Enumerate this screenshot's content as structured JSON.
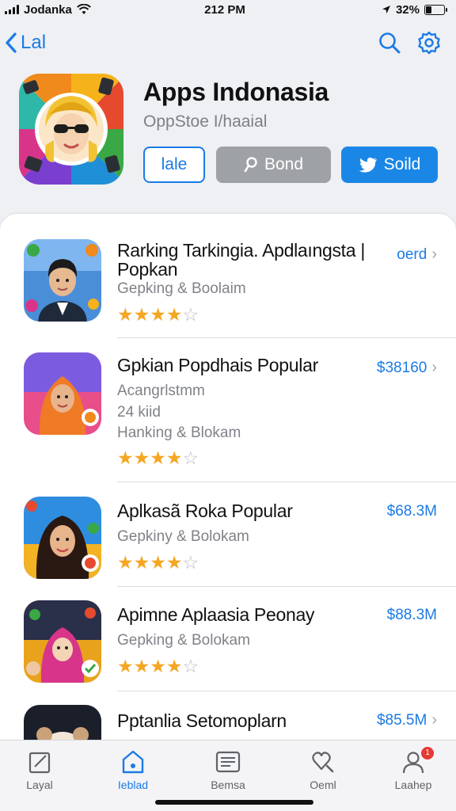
{
  "status_bar": {
    "carrier": "Jodanka",
    "time": "212 PM",
    "battery": "32%",
    "battery_level": 0.32
  },
  "nav": {
    "back_label": "Lal"
  },
  "header": {
    "title": "Apps Indonasia",
    "subtitle": "OppStoe I/haaial",
    "buttons": {
      "sale": "lale",
      "bond": "Bond",
      "sold": "Soild"
    }
  },
  "list": [
    {
      "name": "Rarking Tarkingia. Apdlaıngsta | Popkan",
      "lines": [
        "Gepking & Boolaim"
      ],
      "rating": 4,
      "price": "oerd"
    },
    {
      "name": "Gpkian Popdhais Popular",
      "lines": [
        "Acangrlstmm",
        "24 kiid",
        "Hanking & Blokam"
      ],
      "rating": 4,
      "price": "$38160"
    },
    {
      "name": "Aplkasã Roka Popular",
      "lines": [
        "Gepkiny & Bolokam"
      ],
      "rating": 4,
      "price": "$68.3M"
    },
    {
      "name": "Apimne Aplaasia Peonay",
      "lines": [
        "Gepking & Bolokam"
      ],
      "rating": 4,
      "price": "$88.3M"
    },
    {
      "name": "Pptanlia Setomoplarn",
      "lines": [],
      "rating": 0,
      "price": "$85.5M"
    }
  ],
  "tabbar": {
    "items": [
      {
        "label": "Layal",
        "icon": "square-pencil-icon"
      },
      {
        "label": "Ieblad",
        "icon": "home-icon"
      },
      {
        "label": "Bemsa",
        "icon": "newspaper-icon"
      },
      {
        "label": "Oeml",
        "icon": "search-heart-icon"
      },
      {
        "label": "Laahep",
        "icon": "person-icon",
        "badge": "1"
      }
    ],
    "active_index": 1
  },
  "colors": {
    "accent": "#1a7be6",
    "star": "#f5a623",
    "secondary_button": "#9ea1a6"
  }
}
